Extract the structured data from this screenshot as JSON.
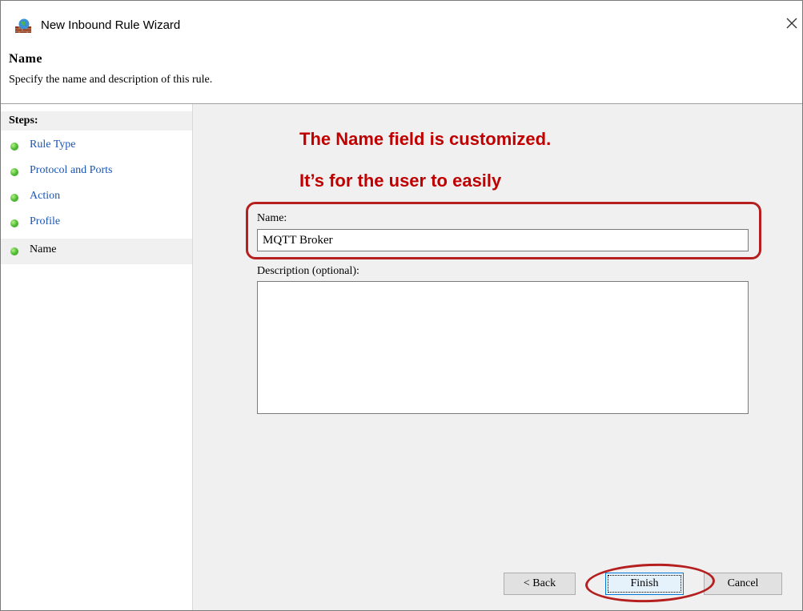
{
  "window": {
    "title": "New Inbound Rule Wizard",
    "close_glyph": "✕"
  },
  "header": {
    "title": "Name",
    "subtitle": "Specify the name and description of this rule."
  },
  "steps": {
    "heading": "Steps:",
    "items": [
      {
        "label": "Rule Type",
        "active": false
      },
      {
        "label": "Protocol and Ports",
        "active": false
      },
      {
        "label": "Action",
        "active": false
      },
      {
        "label": "Profile",
        "active": false
      },
      {
        "label": "Name",
        "active": true
      }
    ]
  },
  "annotations": {
    "line1": "The Name field is customized.",
    "line2": "It’s for the user to easily"
  },
  "form": {
    "name_label": "Name:",
    "name_value": "MQTT Broker",
    "description_label": "Description (optional):",
    "description_value": ""
  },
  "buttons": {
    "back": "< Back",
    "finish": "Finish",
    "cancel": "Cancel"
  },
  "colors": {
    "annotation_red": "#c00000",
    "step_link_blue": "#1a55b3",
    "pane_gray": "#f0f0f0"
  },
  "icons": [
    "firewall-wizard-icon",
    "close-icon",
    "step-bullet-icon"
  ]
}
